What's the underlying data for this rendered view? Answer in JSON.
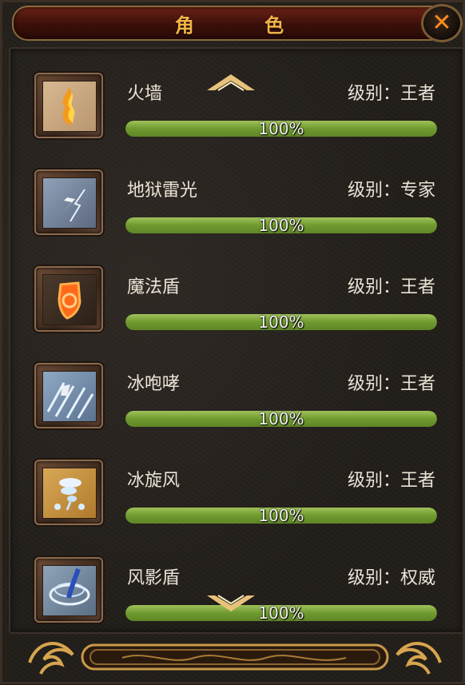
{
  "window": {
    "title": "角 色",
    "close_label": "✕"
  },
  "skills": [
    {
      "name": "火墙",
      "level": "级别：王者",
      "progress_text": "100%",
      "progress": 1.0,
      "icon": "fire-wall-icon"
    },
    {
      "name": "地狱雷光",
      "level": "级别：专家",
      "progress_text": "100%",
      "progress": 1.0,
      "icon": "hell-lightning-icon"
    },
    {
      "name": "魔法盾",
      "level": "级别：王者",
      "progress_text": "100%",
      "progress": 1.0,
      "icon": "magic-shield-icon"
    },
    {
      "name": "冰咆哮",
      "level": "级别：王者",
      "progress_text": "100%",
      "progress": 1.0,
      "icon": "ice-roar-icon"
    },
    {
      "name": "冰旋风",
      "level": "级别：王者",
      "progress_text": "100%",
      "progress": 1.0,
      "icon": "ice-whirlwind-icon"
    },
    {
      "name": "风影盾",
      "level": "级别：权威",
      "progress_text": "100%",
      "progress": 1.0,
      "icon": "wind-shadow-shield-icon"
    }
  ],
  "colors": {
    "title": "#f3b447",
    "bar_fill": "#7ea53b",
    "close": "#ff8a1f"
  }
}
